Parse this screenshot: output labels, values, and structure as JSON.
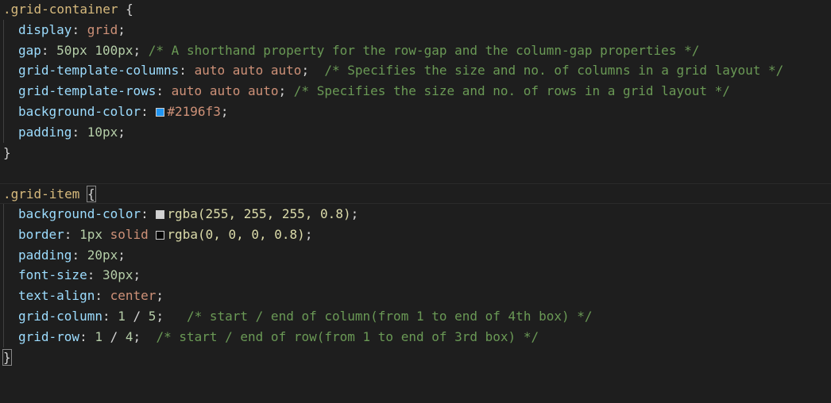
{
  "colors": {
    "swatch_blue": "#2196f3",
    "swatch_white": "rgba(255, 255, 255, 0.8)",
    "swatch_black": "rgba(0, 0, 0, 0.8)"
  },
  "rules": [
    {
      "selector": ".grid-container",
      "open": "{",
      "close": "}",
      "declarations": [
        {
          "property": "display",
          "value": "grid",
          "comment": ""
        },
        {
          "property": "gap",
          "value": "50px 100px",
          "comment": "/* A shorthand property for the row-gap and the column-gap properties */"
        },
        {
          "property": "grid-template-columns",
          "value": "auto auto auto",
          "comment": "/* Specifies the size and no. of columns in a grid layout */"
        },
        {
          "property": "grid-template-rows",
          "value": "auto auto auto",
          "comment": "/* Specifies the size and no. of rows in a grid layout */"
        },
        {
          "property": "background-color",
          "value": "#2196f3",
          "comment": ""
        },
        {
          "property": "padding",
          "value": "10px",
          "comment": ""
        }
      ]
    },
    {
      "selector": ".grid-item",
      "open": "{",
      "close": "}",
      "declarations": [
        {
          "property": "background-color",
          "value": "rgba(255, 255, 255, 0.8)",
          "comment": ""
        },
        {
          "property": "border",
          "value": "1px solid rgba(0, 0, 0, 0.8)",
          "comment": ""
        },
        {
          "property": "padding",
          "value": "20px",
          "comment": ""
        },
        {
          "property": "font-size",
          "value": "30px",
          "comment": ""
        },
        {
          "property": "text-align",
          "value": "center",
          "comment": ""
        },
        {
          "property": "grid-column",
          "value": "1 / 5",
          "comment": "/* start / end of column(from 1 to end of 4th box) */"
        },
        {
          "property": "grid-row",
          "value": "1 / 4",
          "comment": "/* start / end of row(from 1 to end of 3rd box) */"
        }
      ]
    }
  ],
  "tokens": {
    "display_val": "grid",
    "gap_num1": "50px",
    "gap_num2": "100px",
    "auto": "auto",
    "hex_blue": "#2196f3",
    "pad10": "10px",
    "rgba_white": "rgba(255, 255, 255, 0.8)",
    "border_num": "1px",
    "border_style": "solid",
    "rgba_black": "rgba(0, 0, 0, 0.8)",
    "pad20": "20px",
    "fs30": "30px",
    "center": "center",
    "col_1": "1",
    "col_5": "5",
    "row_1": "1",
    "row_4": "4",
    "slash": "/"
  }
}
